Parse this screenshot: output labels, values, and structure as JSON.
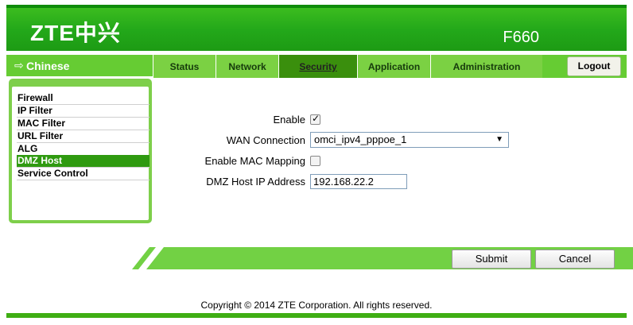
{
  "header": {
    "logo": "ZTE中兴",
    "model": "F660"
  },
  "language": {
    "label": "Chinese",
    "icon": "arrow-right-icon"
  },
  "tabs": [
    {
      "label": "Status"
    },
    {
      "label": "Network"
    },
    {
      "label": "Security"
    },
    {
      "label": "Application"
    },
    {
      "label": "Administration"
    }
  ],
  "active_tab": "Security",
  "logout_label": "Logout",
  "sidebar": {
    "items": [
      {
        "label": "Firewall"
      },
      {
        "label": "IP Filter"
      },
      {
        "label": "MAC Filter"
      },
      {
        "label": "URL Filter"
      },
      {
        "label": "ALG"
      },
      {
        "label": "DMZ Host"
      },
      {
        "label": "Service Control"
      }
    ],
    "active": "DMZ Host"
  },
  "form": {
    "enable_label": "Enable",
    "enable_checked": true,
    "wan_label": "WAN Connection",
    "wan_value": "omci_ipv4_pppoe_1",
    "mac_label": "Enable MAC Mapping",
    "mac_checked": false,
    "dmz_label": "DMZ Host IP Address",
    "dmz_value": "192.168.22.2"
  },
  "buttons": {
    "submit": "Submit",
    "cancel": "Cancel"
  },
  "footer": {
    "copyright": "Copyright © 2014 ZTE Corporation. All rights reserved."
  },
  "colors": {
    "brand_green": "#23a81a",
    "light_green": "#66cc33",
    "active_tab": "#3a8f0d"
  }
}
